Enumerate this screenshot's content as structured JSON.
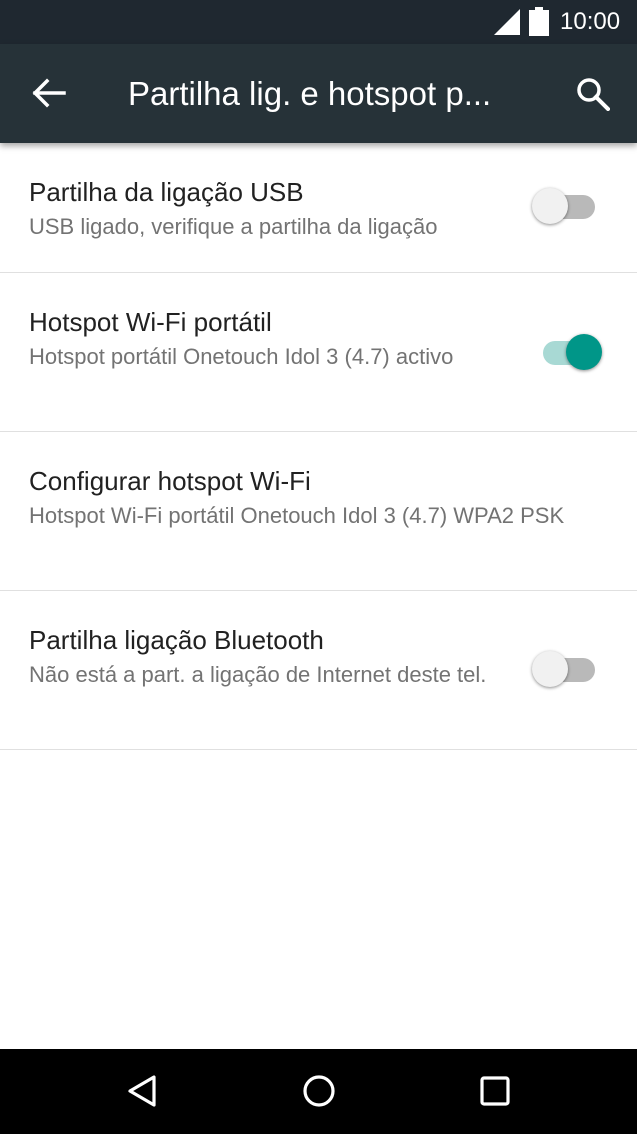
{
  "status_bar": {
    "time": "10:00",
    "icons": [
      "signal-icon",
      "battery-icon"
    ]
  },
  "app_bar": {
    "title": "Partilha lig. e hotspot p...",
    "back_icon": "arrow-left-icon",
    "search_icon": "search-icon",
    "bar_color": "#263238"
  },
  "settings": [
    {
      "title": "Partilha da ligação USB",
      "summary": "USB ligado, verifique a partilha da ligação",
      "toggle": false
    },
    {
      "title": "Hotspot Wi-Fi portátil",
      "summary": "Hotspot portátil Onetouch Idol 3 (4.7) activo",
      "toggle": true
    },
    {
      "title": "Configurar hotspot Wi-Fi",
      "summary": "Hotspot Wi-Fi portátil Onetouch Idol 3 (4.7) WPA2 PSK"
    },
    {
      "title": "Partilha ligação Bluetooth",
      "summary": "Não está a part. a ligação de Internet deste tel.",
      "toggle": false
    }
  ],
  "nav_bar": {
    "buttons": [
      "back-triangle-icon",
      "home-circle-icon",
      "recents-square-icon"
    ]
  },
  "colors": {
    "accent": "#009688",
    "accent_track": "#a8d9d4",
    "status_bar": "#1f2830"
  }
}
